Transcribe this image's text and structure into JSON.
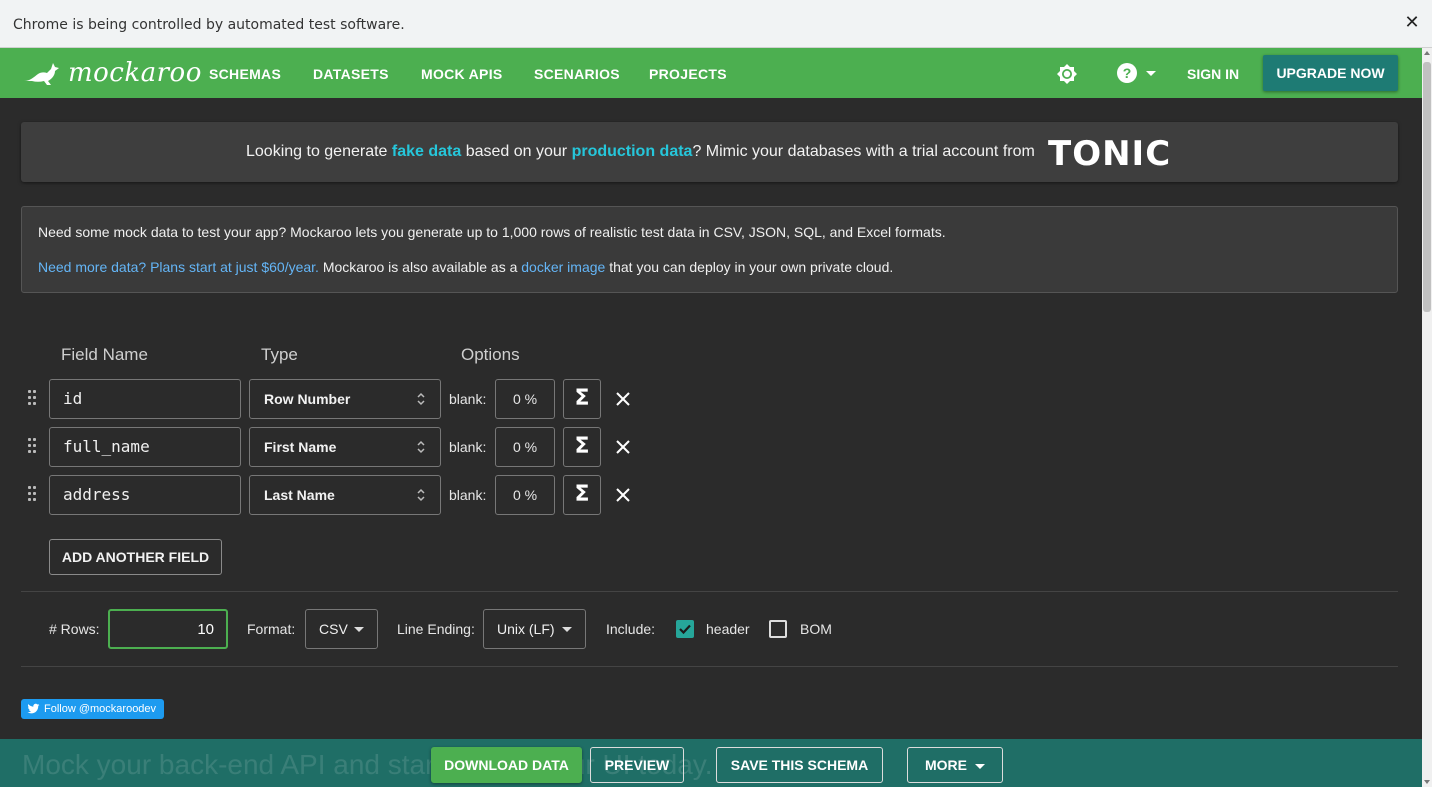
{
  "infobar": {
    "message": "Chrome is being controlled by automated test software.",
    "close_glyph": "✕"
  },
  "navbar": {
    "logo_text": "mockaroo",
    "links": [
      "SCHEMAS",
      "DATASETS",
      "MOCK APIS",
      "SCENARIOS",
      "PROJECTS"
    ],
    "sign_in": "SIGN IN",
    "upgrade": "UPGRADE NOW",
    "icons": [
      "kangaroo-logo-icon",
      "brightness-icon",
      "help-icon",
      "chevron-down-icon"
    ]
  },
  "tonic_banner": {
    "t1": "Looking to generate ",
    "h1": "fake data",
    "t2": " based on your ",
    "h2": "production data",
    "t3": "? Mimic your databases with a trial account from",
    "brand": "TONIC"
  },
  "info": {
    "line1": "Need some mock data to test your app? Mockaroo lets you generate up to 1,000 rows of realistic test data in CSV, JSON, SQL, and Excel formats.",
    "link1": "Need more data? Plans start at just $60/year.",
    "t2": " Mockaroo is also available as a ",
    "link2": "docker image",
    "t3": " that you can deploy in your own private cloud."
  },
  "fields": {
    "headers": {
      "name": "Field Name",
      "type": "Type",
      "options": "Options"
    },
    "rows": [
      {
        "name": "id",
        "type": "Row Number",
        "blank_label": "blank:",
        "blank": "0 %",
        "sigma": "Σ"
      },
      {
        "name": "full_name",
        "type": "First Name",
        "blank_label": "blank:",
        "blank": "0 %",
        "sigma": "Σ"
      },
      {
        "name": "address",
        "type": "Last Name",
        "blank_label": "blank:",
        "blank": "0 %",
        "sigma": "Σ"
      }
    ],
    "add_button": "ADD ANOTHER FIELD"
  },
  "options": {
    "rows_label": "# Rows:",
    "rows_value": "10",
    "format_label": "Format:",
    "format_value": "CSV",
    "line_ending_label": "Line Ending:",
    "line_ending_value": "Unix (LF)",
    "include_label": "Include:",
    "header_label": "header",
    "header_checked": true,
    "bom_label": "BOM",
    "bom_checked": false
  },
  "follow": "Follow @mockaroodev",
  "actionbar": {
    "ghost_text": "Mock your back-end API and start coding your UI today.",
    "download": "DOWNLOAD DATA",
    "preview": "PREVIEW",
    "save": "SAVE THIS SCHEMA",
    "more": "MORE"
  },
  "colors": {
    "green": "#4caf50",
    "teal": "#1e7b74",
    "highlight": "#26c6da",
    "link": "#64b5f6",
    "dark_bg": "#2b2b2b"
  }
}
